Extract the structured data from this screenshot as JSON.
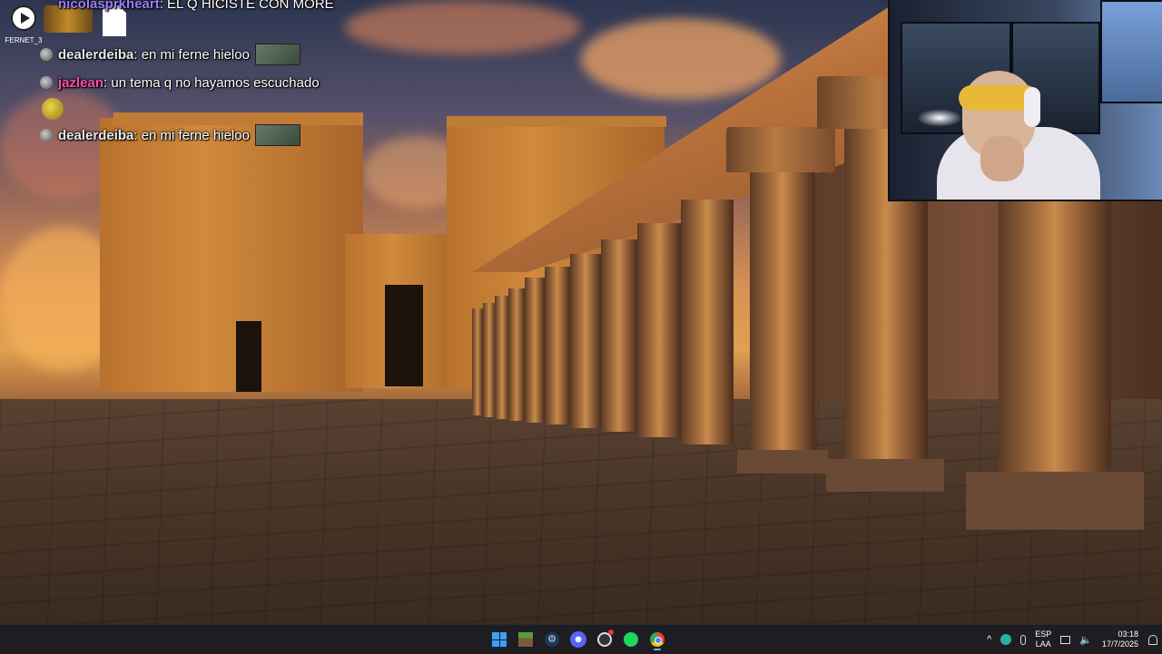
{
  "desktop": {
    "icons": [
      {
        "label": "FERNET_3"
      },
      {
        "label": ""
      },
      {
        "label": ""
      }
    ]
  },
  "chat": {
    "messages": [
      {
        "user": "nicolasprkheart",
        "text": ": EL Q HICISTE CON MORE",
        "user_color": "#9a7cff"
      },
      {
        "user": "dealerdeiba",
        "text": " : en mi ferne hieloo",
        "user_color": "#e8e8e8"
      },
      {
        "user": "jazlean",
        "text": ": un tema q no hayamos escuchado",
        "user_color": "#ff4da6"
      },
      {
        "user": "dealerdeiba",
        "text": " : en mi ferne hieloo",
        "user_color": "#e8e8e8"
      }
    ]
  },
  "taskbar": {
    "apps": [
      {
        "name": "start",
        "icon": "windows-icon"
      },
      {
        "name": "minecraft",
        "icon": "minecraft-icon"
      },
      {
        "name": "steam",
        "icon": "steam-icon"
      },
      {
        "name": "discord",
        "icon": "discord-icon"
      },
      {
        "name": "obs",
        "icon": "obs-icon"
      },
      {
        "name": "spotify",
        "icon": "spotify-icon"
      },
      {
        "name": "chrome",
        "icon": "chrome-icon"
      }
    ],
    "tray": {
      "chevron": "^",
      "lang_top": "ESP",
      "lang_bottom": "LAA",
      "time": "03:18",
      "date": "17/7/2025"
    }
  },
  "colors": {
    "taskbar_bg": "#1e1e22",
    "accent": "#3aa0ff"
  }
}
